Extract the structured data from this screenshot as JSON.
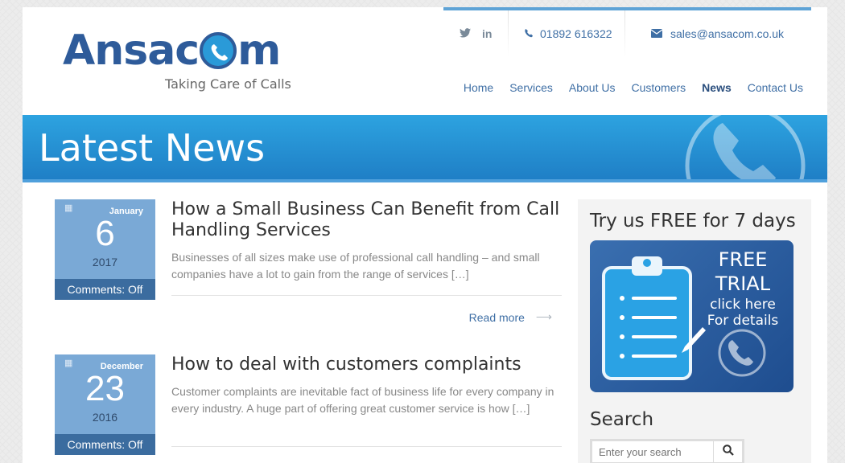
{
  "brand": {
    "logo_text": "Ansacom",
    "tagline": "Taking Care of Calls"
  },
  "topbar": {
    "social_icons": [
      "twitter-icon",
      "linkedin-icon"
    ],
    "twitter": "𝕏",
    "linkedin": "in",
    "phone": "01892 616322",
    "email": "sales@ansacom.co.uk"
  },
  "nav": {
    "items": [
      {
        "label": "Home"
      },
      {
        "label": "Services"
      },
      {
        "label": "About Us"
      },
      {
        "label": "Customers"
      },
      {
        "label": "News",
        "active": true
      },
      {
        "label": "Contact Us"
      }
    ]
  },
  "banner": {
    "title": "Latest News"
  },
  "posts": [
    {
      "month": "January",
      "day": "6",
      "year": "2017",
      "comments": "Comments: Off",
      "title": "How a Small Business Can Benefit from Call Handling Services",
      "excerpt": "Businesses of all sizes make use of professional call handling – and small companies have a lot to gain from the range of services […]",
      "read_more": "Read more"
    },
    {
      "month": "December",
      "day": "23",
      "year": "2016",
      "comments": "Comments: Off",
      "title": "How to deal with customers complaints",
      "excerpt": "Customer complaints are inevitable fact of business life for every company in every industry. A huge part of offering great customer service is how […]"
    }
  ],
  "sidebar": {
    "trial_heading": "Try us FREE for 7 days",
    "promo": {
      "line1": "FREE",
      "line2": "TRIAL",
      "line3": "click here",
      "line4": "For details"
    },
    "search_heading": "Search",
    "search_placeholder": "Enter your search"
  },
  "colors": {
    "brand_blue": "#2e5b9a",
    "banner_blue": "#2da3e0",
    "link_blue": "#3f6fa5",
    "date_box": "#7aa9d6"
  }
}
